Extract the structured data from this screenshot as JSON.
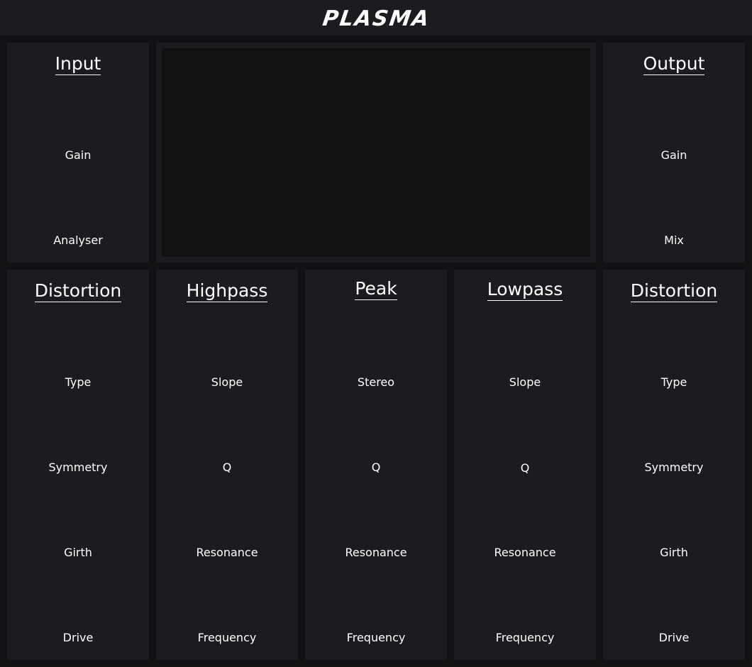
{
  "header": {
    "logo": "PLASMA"
  },
  "input": {
    "title": "Input",
    "gain_label": "Gain",
    "analyser_label": "Analyser"
  },
  "output": {
    "title": "Output",
    "gain_label": "Gain",
    "mix_label": "Mix"
  },
  "distortion_left": {
    "title": "Distortion",
    "labels": [
      "Type",
      "Symmetry",
      "Girth",
      "Drive"
    ]
  },
  "highpass": {
    "title": "Highpass",
    "labels": [
      "Slope",
      "Q",
      "Resonance",
      "Frequency"
    ]
  },
  "peak": {
    "title": "Peak",
    "labels": [
      "Stereo",
      "Q",
      "Resonance",
      "Frequency"
    ]
  },
  "lowpass": {
    "title": "Lowpass",
    "labels": [
      "Slope",
      "Q",
      "Resonance",
      "Frequency"
    ]
  },
  "distortion_right": {
    "title": "Distortion",
    "labels": [
      "Type",
      "Symmetry",
      "Girth",
      "Drive"
    ]
  }
}
